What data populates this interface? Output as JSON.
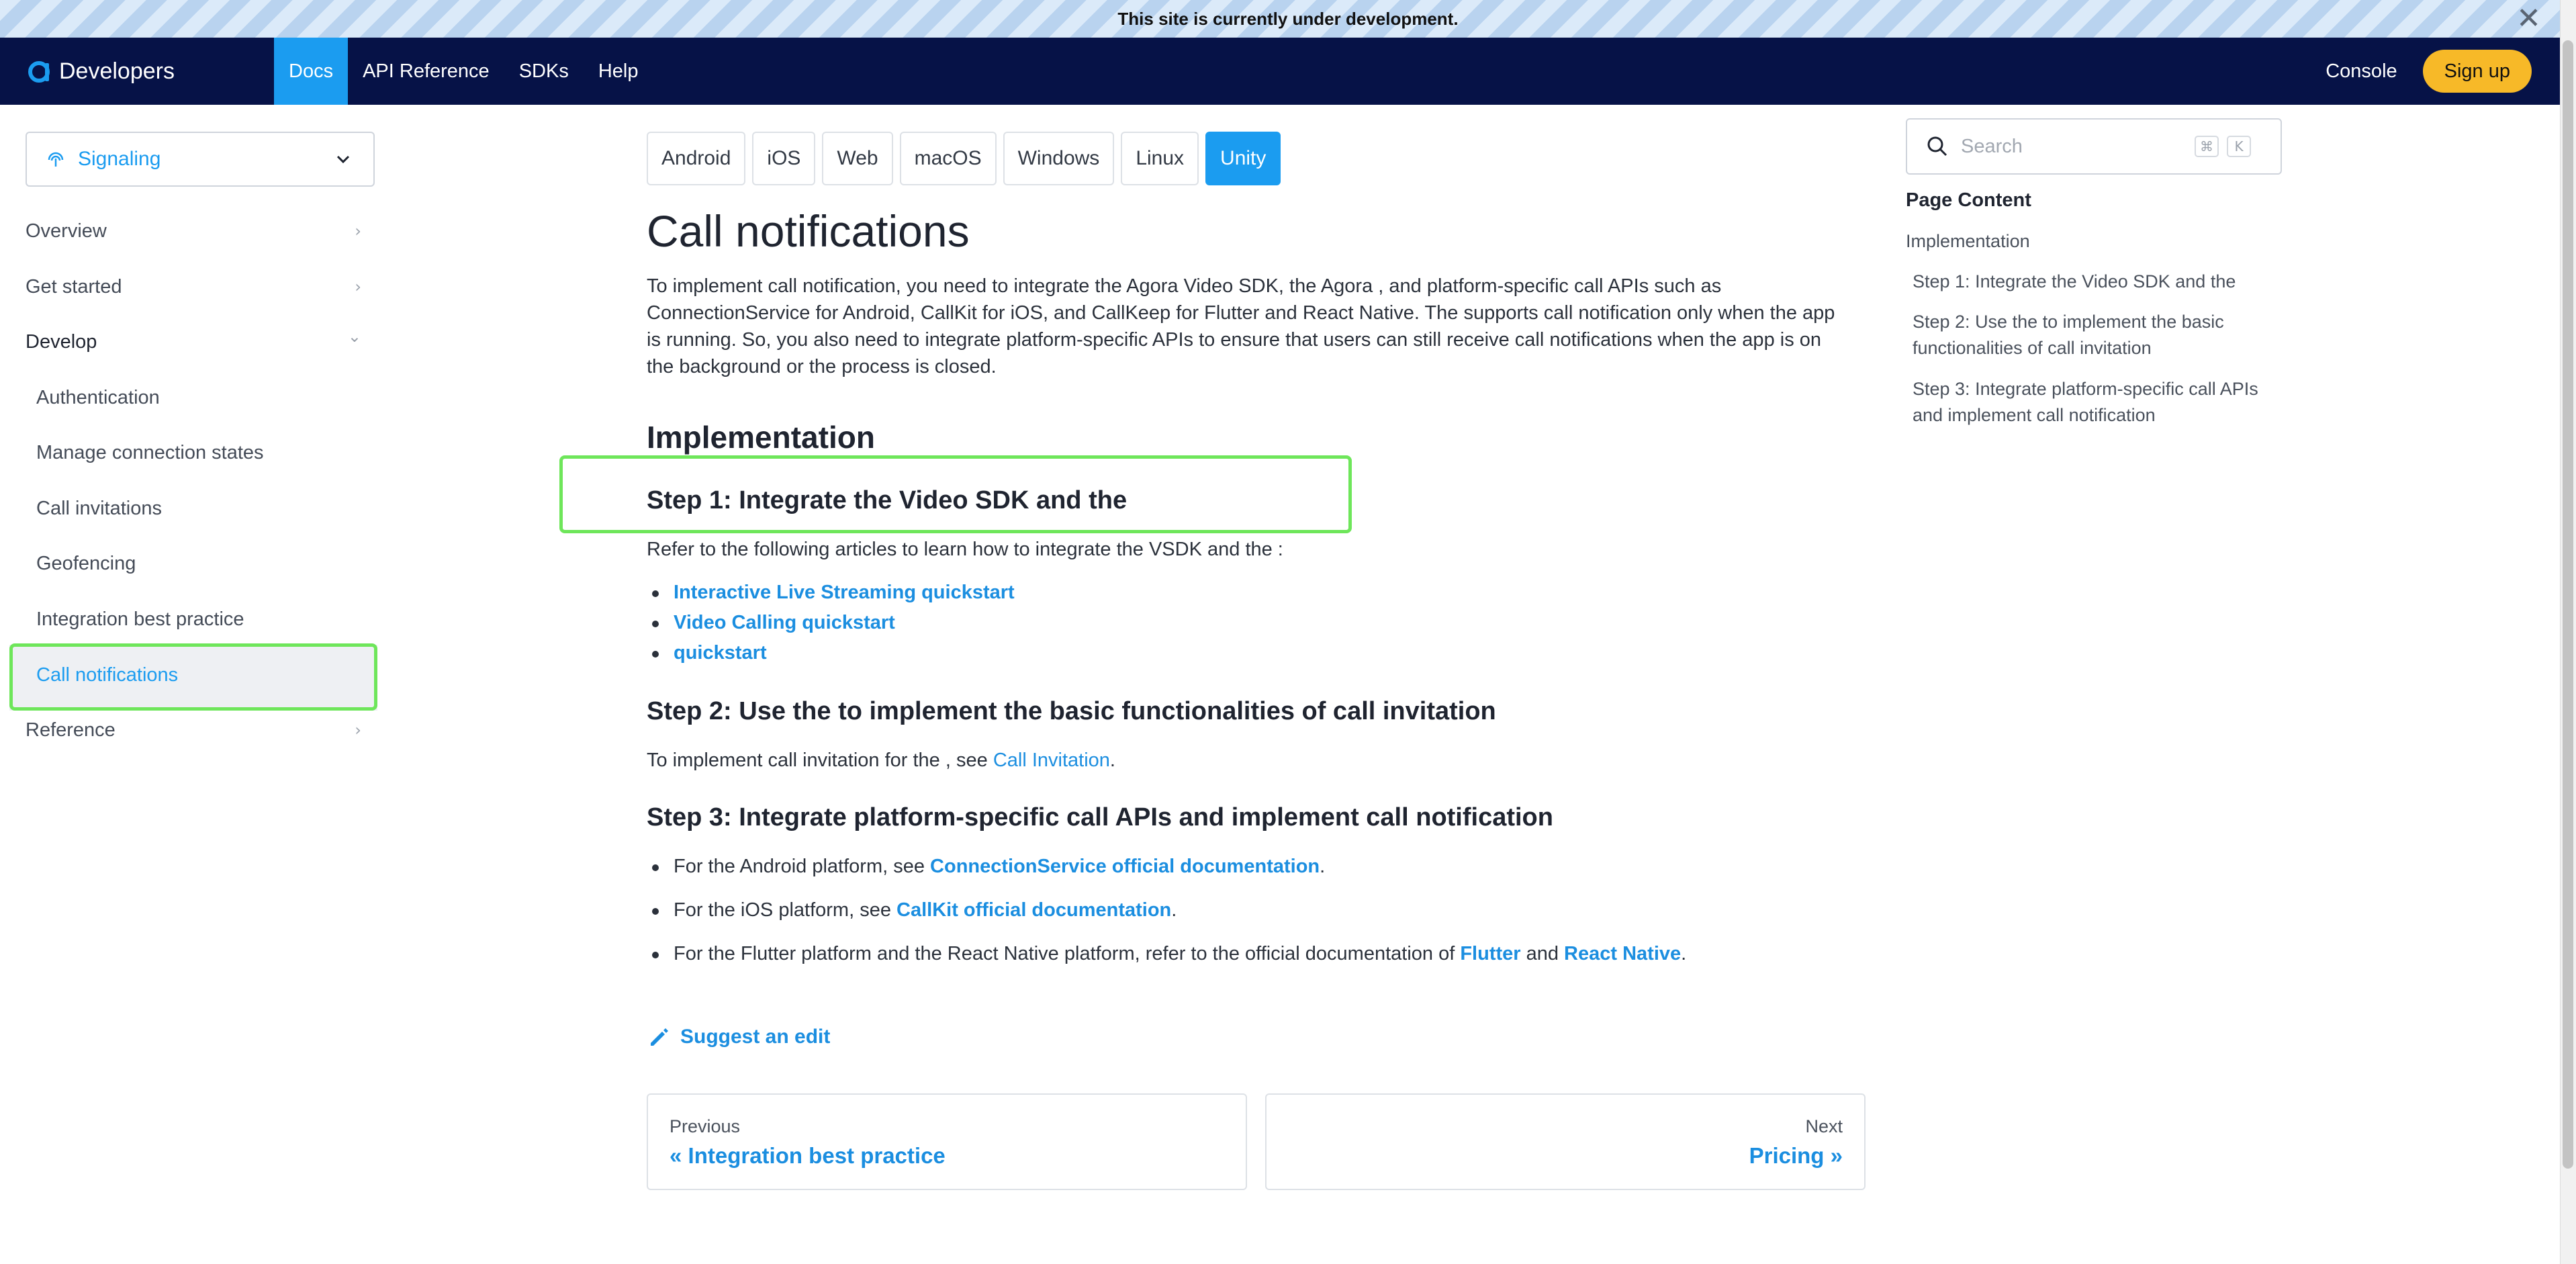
{
  "announcement": {
    "text": "This site is currently under development.",
    "close_symbol": "✕"
  },
  "navbar": {
    "brand": "Developers",
    "items": [
      "Docs",
      "API Reference",
      "SDKs",
      "Help"
    ],
    "active": "Docs",
    "console": "Console",
    "signup": "Sign up",
    "colors": {
      "bg": "#061247",
      "accent": "#1b9cf0",
      "signup": "#f7b928"
    }
  },
  "sidebar": {
    "product": "Signaling",
    "items": [
      {
        "label": "Overview",
        "arrow": "›"
      },
      {
        "label": "Get started",
        "arrow": "›"
      },
      {
        "label": "Develop",
        "arrow": "⌄"
      },
      {
        "label": "Authentication"
      },
      {
        "label": "Manage connection states"
      },
      {
        "label": "Call invitations"
      },
      {
        "label": "Geofencing"
      },
      {
        "label": "Integration best practice"
      },
      {
        "label": "Call notifications"
      },
      {
        "label": "Reference",
        "arrow": "›"
      }
    ]
  },
  "platform_tabs": [
    "Android",
    "iOS",
    "Web",
    "macOS",
    "Windows",
    "Linux",
    "Unity"
  ],
  "active_platform": "Unity",
  "content": {
    "title": "Call notifications",
    "intro_lines": [
      "To implement call notification, you need to integrate the Agora Video SDK, the Agora , and platform-specific call APIs such as",
      "ConnectionService for Android, CallKit for iOS, and CallKeep for Flutter and React Native. The supports call notification only when the app",
      "is running. So, you also need to integrate platform-specific APIs to ensure that users can still receive call notifications when the app is on",
      "the background or the process is closed."
    ],
    "implementation_heading": "Implementation",
    "step1": {
      "heading": "Step 1: Integrate the Video SDK and the",
      "text": "Refer to the following articles to learn how to integrate the VSDK and the :",
      "links": [
        "Interactive Live Streaming quickstart",
        "Video Calling quickstart",
        "quickstart"
      ]
    },
    "step2": {
      "heading": "Step 2: Use the to implement the basic functionalities of call invitation",
      "text": "To implement call invitation for the , see ",
      "link": "Call Invitation",
      "end": "."
    },
    "step3": {
      "heading": "Step 3: Integrate platform-specific call APIs and implement call notification",
      "b1": {
        "pre": "For the Android platform, see ",
        "link": "ConnectionService official documentation",
        "post": "."
      },
      "b2": {
        "pre": "For the iOS platform, see ",
        "link": "CallKit official documentation",
        "post": "."
      },
      "b3": {
        "pre": "For the Flutter platform and the React Native platform, refer to the official documentation of ",
        "link1": "Flutter",
        "mid": " and ",
        "link2": "React Native",
        "post": "."
      }
    },
    "suggest_edit": "Suggest an edit",
    "pager": {
      "prev_label": "Previous",
      "prev_title": "« Integration best practice",
      "next_label": "Next",
      "next_title": "Pricing »"
    }
  },
  "toc": {
    "search_placeholder": "Search",
    "shortcut_keys": [
      "⌘",
      "K"
    ],
    "heading": "Page Content",
    "items": [
      "Implementation",
      "Step 1: Integrate the Video SDK and the",
      "Step 2: Use the to implement the basic functionalities of call invitation",
      "Step 3: Integrate platform-specific call APIs and implement call notification"
    ]
  }
}
